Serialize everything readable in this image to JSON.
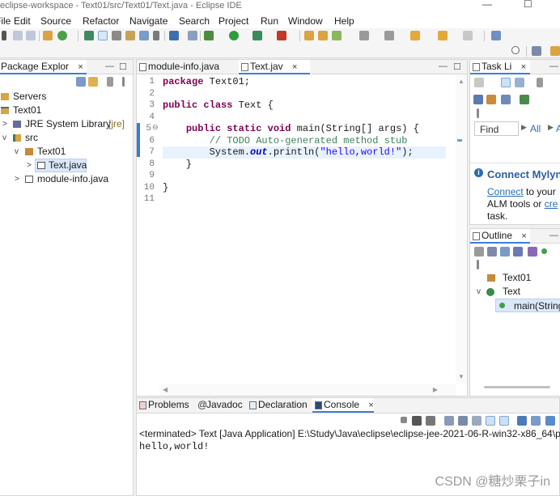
{
  "window": {
    "title": "eclipse-workspace - Text01/src/Text01/Text.java - Eclipse IDE",
    "min_glyph": "—",
    "max_glyph": "☐"
  },
  "menu": [
    "File",
    "Edit",
    "Source",
    "Refactor",
    "Navigate",
    "Search",
    "Project",
    "Run",
    "Window",
    "Help"
  ],
  "package_explorer": {
    "tab_label": "Package Explor",
    "close": "×",
    "tree": [
      {
        "label": "Servers",
        "icon": "folder-icon",
        "expander": ">"
      },
      {
        "label": "Text01",
        "icon": "project-icon",
        "expander": "v"
      },
      {
        "label": "JRE System Library",
        "suffix": "[jre]",
        "icon": "library-icon",
        "expander": ">"
      },
      {
        "label": "src",
        "icon": "source-folder-icon",
        "expander": "v"
      },
      {
        "label": "Text01",
        "icon": "package-icon",
        "expander": "v"
      },
      {
        "label": "Text.java",
        "icon": "java-file-icon",
        "expander": ">"
      },
      {
        "label": "module-info.java",
        "icon": "java-file-icon",
        "expander": ">"
      }
    ]
  },
  "editor": {
    "tabs": [
      {
        "label": "module-info.java",
        "active": false
      },
      {
        "label": "Text.jav",
        "active": true,
        "close": "×"
      }
    ],
    "line_numbers": [
      "1",
      "2",
      "3",
      "4",
      "5",
      "6",
      "7",
      "8",
      "9",
      "10",
      "11"
    ],
    "fold_marker": "⊖",
    "code": {
      "l1_kw": "package",
      "l1_rest": " Text01;",
      "l3_kw1": "public",
      "l3_kw2": "class",
      "l3_rest": " Text {",
      "l5_indent": "    ",
      "l5_kw1": "public",
      "l5_kw2": "static",
      "l5_kw3": "void",
      "l5_rest": " main(String[] args) {",
      "l6_comment": "        // TODO Auto-generated method stub",
      "l7_pre": "        System.",
      "l7_field": "out",
      "l7_mid": ".println(",
      "l7_str": "\"hello,world!\"",
      "l7_end": ");",
      "l8": "    }",
      "l10": "}"
    }
  },
  "task_list": {
    "tab_label": "Task Li",
    "close": "×",
    "find_placeholder": "Find",
    "all_label": "All",
    "extra": "A"
  },
  "mylyn": {
    "title": "Connect Mylyn",
    "link1": "Connect",
    "text1": " to your",
    "line2_pre": "ALM tools or ",
    "link2": "cre",
    "line3": "task."
  },
  "outline": {
    "tab_label": "Outline",
    "close": "×",
    "items": [
      {
        "label": "Text01",
        "icon": "package-icon"
      },
      {
        "label": "Text",
        "icon": "class-icon",
        "expander": "v"
      },
      {
        "label": "main(String",
        "icon": "method-icon"
      }
    ]
  },
  "bottom_tabs": [
    {
      "label": "Problems",
      "icon": "problems-icon",
      "active": false
    },
    {
      "label": "Javadoc",
      "icon": "javadoc-icon",
      "active": false
    },
    {
      "label": "Declaration",
      "icon": "declaration-icon",
      "active": false
    },
    {
      "label": "Console",
      "icon": "console-icon",
      "active": true,
      "close": "×"
    }
  ],
  "console": {
    "status_line": "<terminated> Text [Java Application] E:\\Study\\Java\\eclipse\\eclipse-jee-2021-06-R-win32-x86_64\\p",
    "output": "hello,world!"
  },
  "watermark": "CSDN @糖炒栗子in"
}
